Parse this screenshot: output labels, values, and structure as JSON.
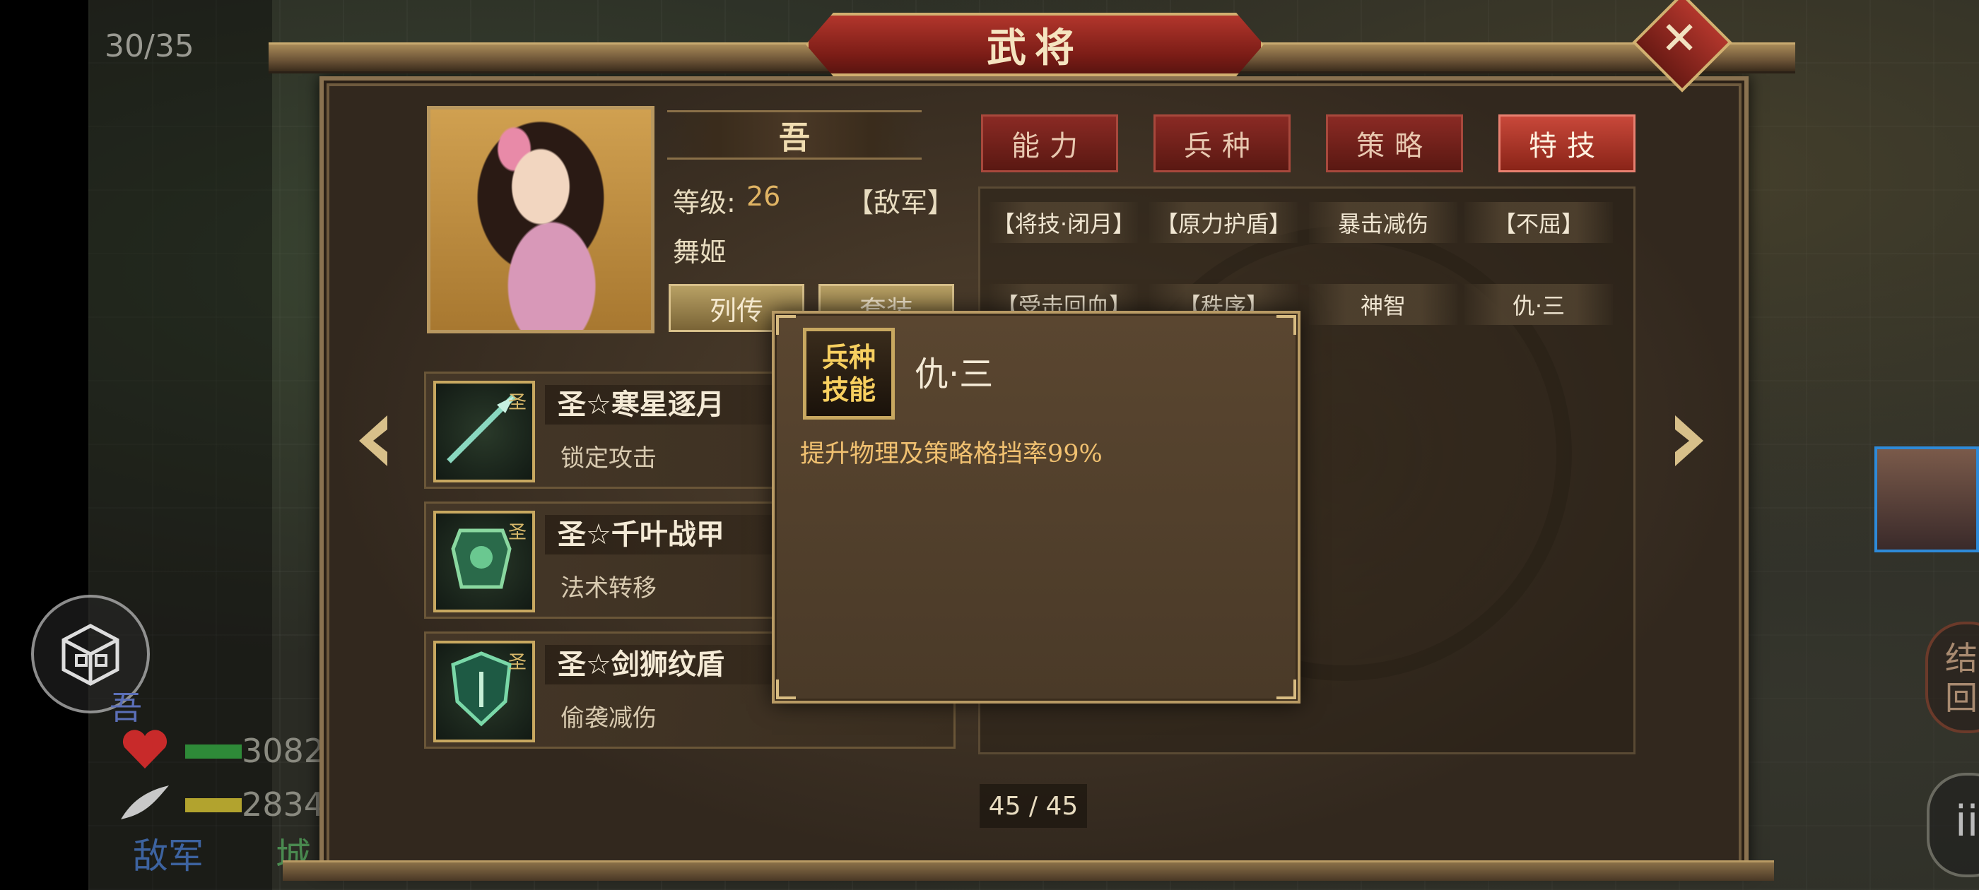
{
  "window": {
    "title": "武将"
  },
  "map": {
    "counter": "30/35",
    "status": {
      "hero_name": "吾",
      "hp_value": "3082",
      "mp_value": "2834",
      "enemy_label": "敌军",
      "city_label": "城"
    },
    "right_round_text": "结\n回",
    "right_round_2_text": "ii"
  },
  "hero": {
    "name": "吾",
    "level_label": "等级:",
    "level_value": "26",
    "faction": "【敌军】",
    "class": "舞姬",
    "bio_button": "列传",
    "equip_button": "套装"
  },
  "tabs": [
    {
      "label": "能力",
      "active": false
    },
    {
      "label": "兵种",
      "active": false
    },
    {
      "label": "策略",
      "active": false
    },
    {
      "label": "特技",
      "active": true
    }
  ],
  "skills": {
    "row1": [
      "【将技·闭月】",
      "【原力护盾】",
      "暴击减伤",
      "【不屈】"
    ],
    "row2": [
      "【受击回血】",
      "【秩序】",
      "神智",
      "仇·三"
    ]
  },
  "equipment": [
    {
      "name": "圣☆寒星逐月",
      "desc": "锁定攻击",
      "icon": "spear-icon"
    },
    {
      "name": "圣☆千叶战甲",
      "desc": "法术转移",
      "icon": "armor-icon"
    },
    {
      "name": "圣☆剑狮纹盾",
      "desc": "偷袭减伤",
      "icon": "shield-icon"
    }
  ],
  "pagination": {
    "label": "45 / 45"
  },
  "tooltip": {
    "badge_line1": "兵种",
    "badge_line2": "技能",
    "title": "仇·三",
    "description": "提升物理及策略格挡率99%"
  },
  "colors": {
    "accent_red": "#8a2a24",
    "gold": "#b89a64",
    "level_value": "#e0b464",
    "tooltip_desc": "#f0c070"
  }
}
